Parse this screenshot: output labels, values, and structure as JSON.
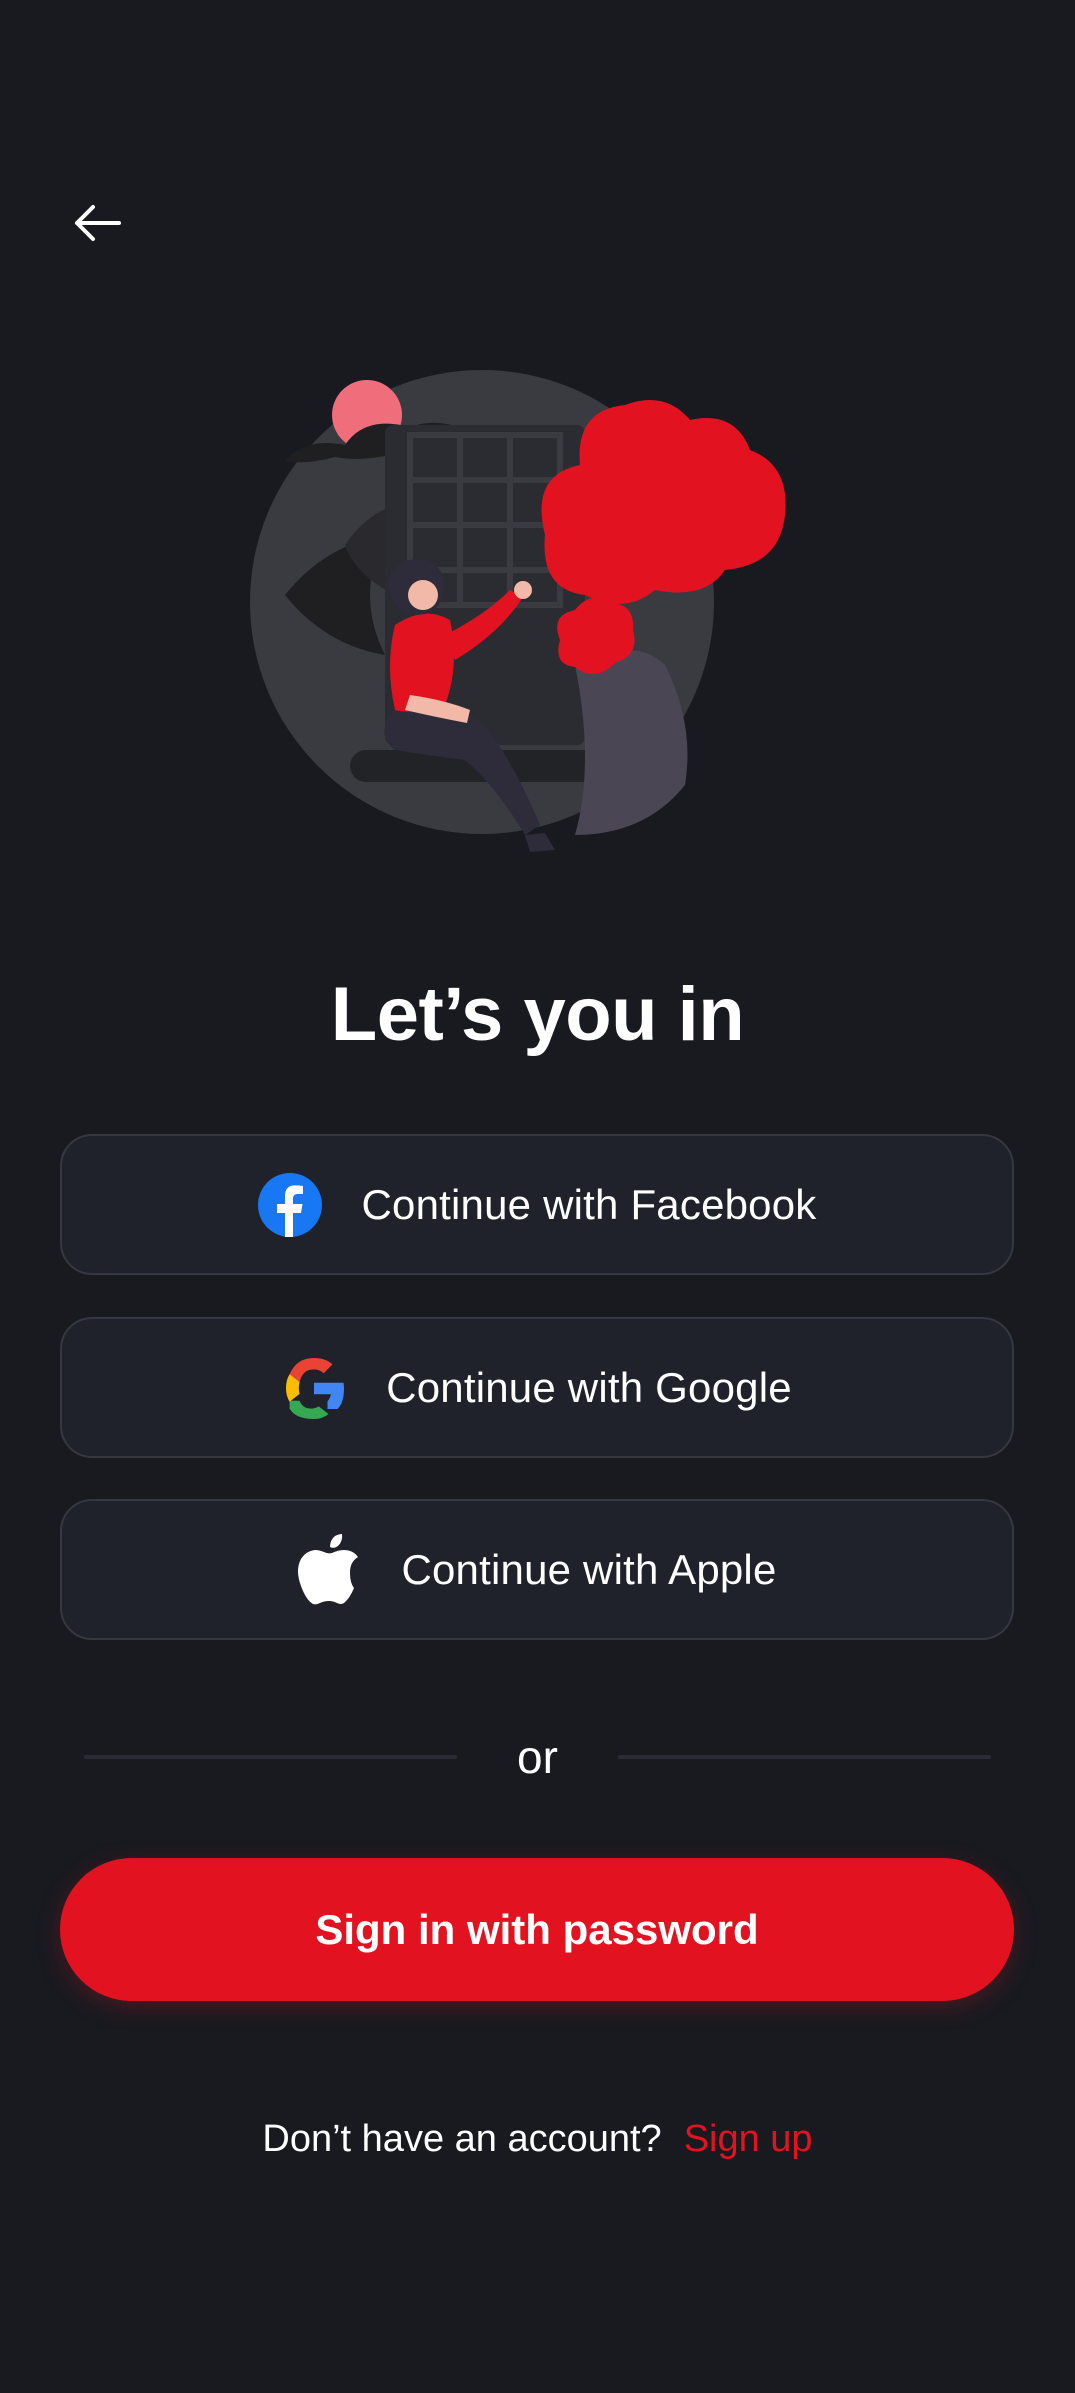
{
  "header": {
    "back_icon": "arrow-left-icon"
  },
  "hero": {
    "illustration": "person-on-swing-illustration"
  },
  "title": "Let’s you in",
  "social": [
    {
      "label": "Continue with Facebook",
      "icon": "facebook-icon"
    },
    {
      "label": "Continue with Google",
      "icon": "google-icon"
    },
    {
      "label": "Continue with Apple",
      "icon": "apple-icon"
    }
  ],
  "divider_text": "or",
  "primary_button": "Sign in with password",
  "footer": {
    "prompt": "Don’t have an account?",
    "link": "Sign up"
  },
  "colors": {
    "background": "#181a20",
    "surface": "#1f222a",
    "border": "#35383f",
    "accent": "#e21221",
    "text": "#ffffff"
  }
}
